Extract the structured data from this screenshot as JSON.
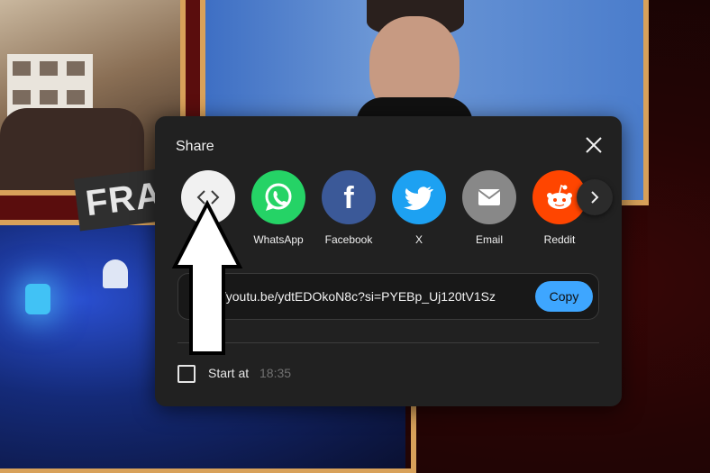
{
  "background": {
    "banner_text": "FRA"
  },
  "dialog": {
    "title": "Share",
    "close_icon": "close-icon",
    "share_targets": [
      {
        "label": "Embed",
        "icon": "embed-icon",
        "color": "#f1f1f1"
      },
      {
        "label": "WhatsApp",
        "icon": "whatsapp-icon",
        "color": "#25d366"
      },
      {
        "label": "Facebook",
        "icon": "facebook-icon",
        "color": "#3b5998"
      },
      {
        "label": "X",
        "icon": "twitter-bird-icon",
        "color": "#1da1f2"
      },
      {
        "label": "Email",
        "icon": "email-icon",
        "color": "#888888"
      },
      {
        "label": "Reddit",
        "icon": "reddit-icon",
        "color": "#ff4500"
      }
    ],
    "next_icon": "chevron-right-icon",
    "url": "https://youtu.be/ydtEDOkoN8c?si=PYEBp_Uj120tV1Sz",
    "copy_label": "Copy",
    "copy_color": "#3ea6ff",
    "start_at_label": "Start at",
    "start_at_time": "18:35",
    "start_at_checked": false
  }
}
